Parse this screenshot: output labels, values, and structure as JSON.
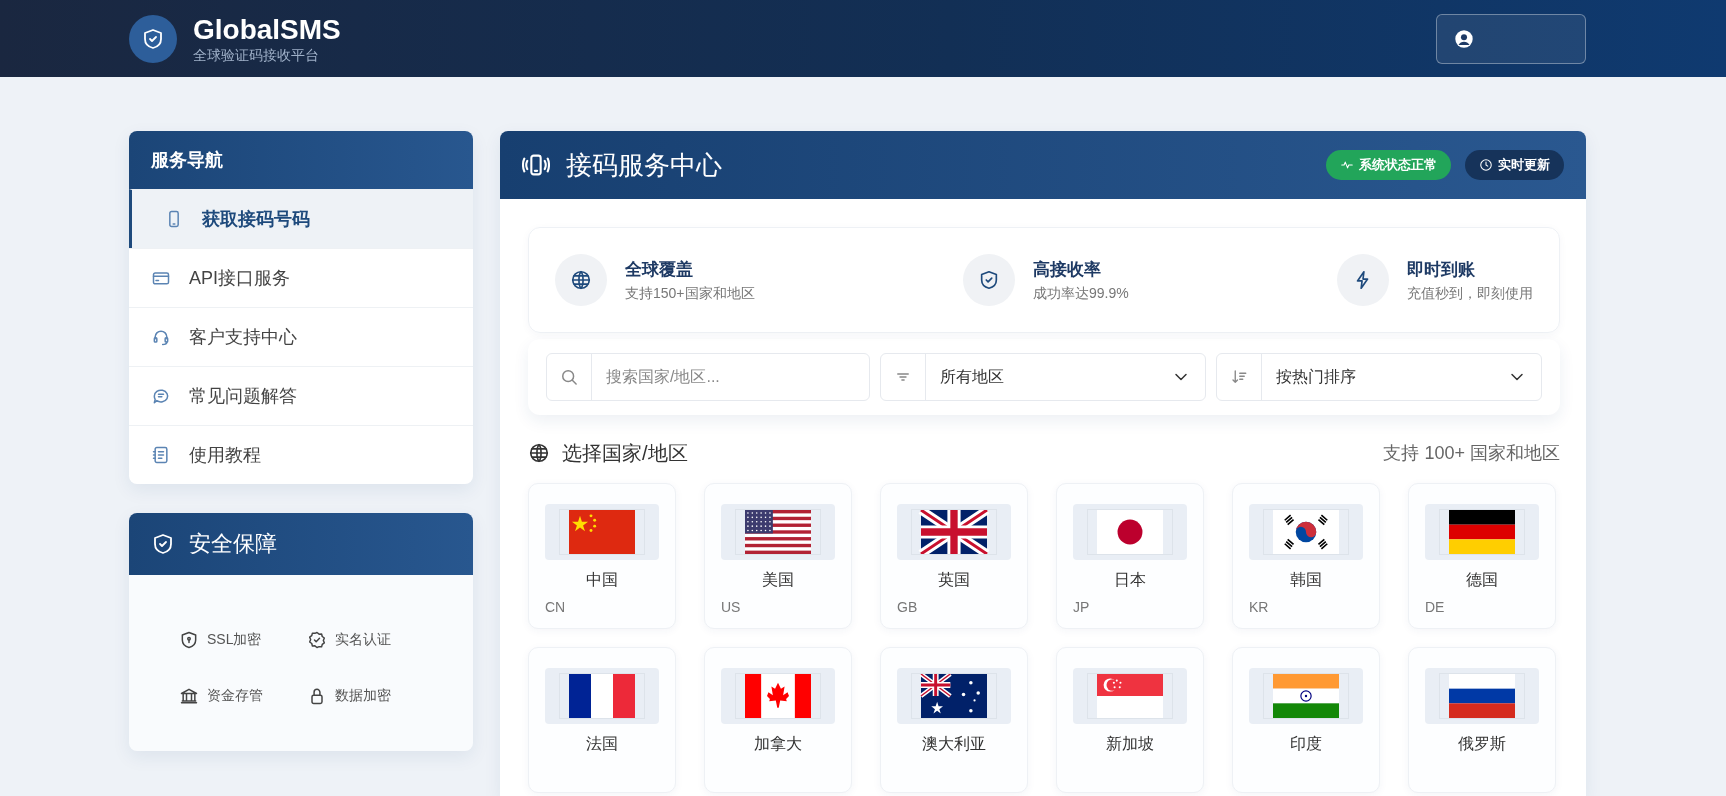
{
  "header": {
    "logo_title": "GlobalSMS",
    "logo_subtitle": "全球验证码接收平台"
  },
  "sidebar": {
    "nav_title": "服务导航",
    "items": [
      {
        "label": "获取接码号码",
        "selected": true
      },
      {
        "label": "API接口服务",
        "selected": false
      },
      {
        "label": "客户支持中心",
        "selected": false
      },
      {
        "label": "常见问题解答",
        "selected": false
      },
      {
        "label": "使用教程",
        "selected": false
      }
    ],
    "security": {
      "title": "安全保障",
      "items": [
        {
          "label": "SSL加密"
        },
        {
          "label": "实名认证"
        },
        {
          "label": "资金存管"
        },
        {
          "label": "数据加密"
        }
      ]
    }
  },
  "panel": {
    "title": "接码服务中心",
    "badges": [
      {
        "label": "系统状态正常",
        "kind": "status"
      },
      {
        "label": "实时更新",
        "kind": "live"
      }
    ],
    "features": [
      {
        "title": "全球覆盖",
        "subtitle": "支持150+国家和地区"
      },
      {
        "title": "高接收率",
        "subtitle": "成功率达99.9%"
      },
      {
        "title": "即时到账",
        "subtitle": "充值秒到，即刻使用"
      }
    ],
    "filters": {
      "search_placeholder": "搜索国家/地区...",
      "region": "所有地区",
      "sort": "按热门排序"
    },
    "section_title": "选择国家/地区",
    "section_note": "支持 100+ 国家和地区",
    "countries": [
      {
        "name": "中国",
        "code": "CN"
      },
      {
        "name": "美国",
        "code": "US"
      },
      {
        "name": "英国",
        "code": "GB"
      },
      {
        "name": "日本",
        "code": "JP"
      },
      {
        "name": "韩国",
        "code": "KR"
      },
      {
        "name": "德国",
        "code": "DE"
      },
      {
        "name": "法国"
      },
      {
        "name": "加拿大"
      },
      {
        "name": "澳大利亚"
      },
      {
        "name": "新加坡"
      },
      {
        "name": "印度"
      },
      {
        "name": "俄罗斯"
      }
    ]
  }
}
